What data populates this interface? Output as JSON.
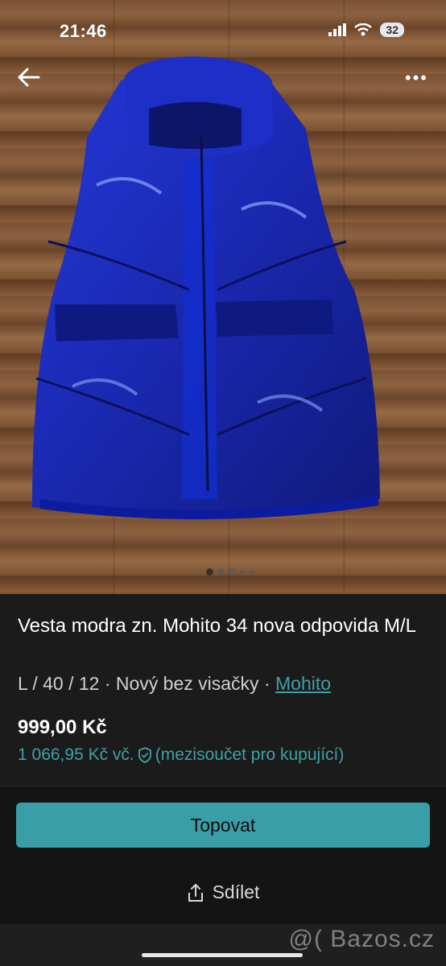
{
  "status": {
    "time": "21:46",
    "battery": "32"
  },
  "nav": {
    "back_icon": "arrow-left-icon",
    "more_icon": "more-dots-icon"
  },
  "gallery": {
    "image_count": 5,
    "active_index": 0
  },
  "listing": {
    "title": "Vesta modra zn. Mohito 34 nova odpovida M/L",
    "subtitle_prefix": "L / 40 / 12 · Nový bez visačky · ",
    "brand": "Mohito",
    "price": "999,00 Kč",
    "buyer_price": "1 066,95 Kč vč.",
    "buyer_note": "(mezisoučet pro kupující)"
  },
  "actions": {
    "topovat_label": "Topovat",
    "share_label": "Sdílet"
  },
  "watermark": "@( Bazos.cz",
  "colors": {
    "accent": "#3a9ea6",
    "link": "#3fa0a6",
    "vest": "#1a2bb8",
    "background": "#1b1b1b"
  }
}
